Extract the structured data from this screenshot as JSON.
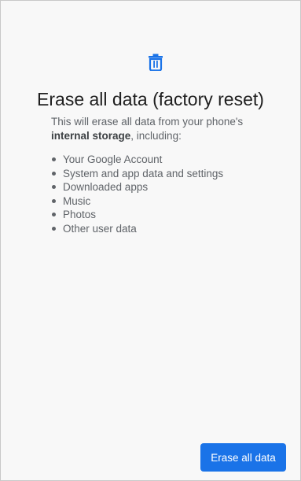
{
  "header": {
    "icon": "trash-icon",
    "title": "Erase all data (factory reset)"
  },
  "intro": {
    "text_before": "This will erase all data from your phone's",
    "bold": "internal storage",
    "text_after": ", including:"
  },
  "data_items": [
    {
      "label": "Your Google Account"
    },
    {
      "label": "System and app data and settings"
    },
    {
      "label": "Downloaded apps"
    },
    {
      "label": "Music"
    },
    {
      "label": "Photos"
    },
    {
      "label": "Other user data"
    }
  ],
  "actions": {
    "erase_label": "Erase all data"
  },
  "colors": {
    "accent": "#1a73e8",
    "background": "#f8f8f8",
    "body_text": "#5f6368",
    "title_text": "#1f1f1f"
  }
}
